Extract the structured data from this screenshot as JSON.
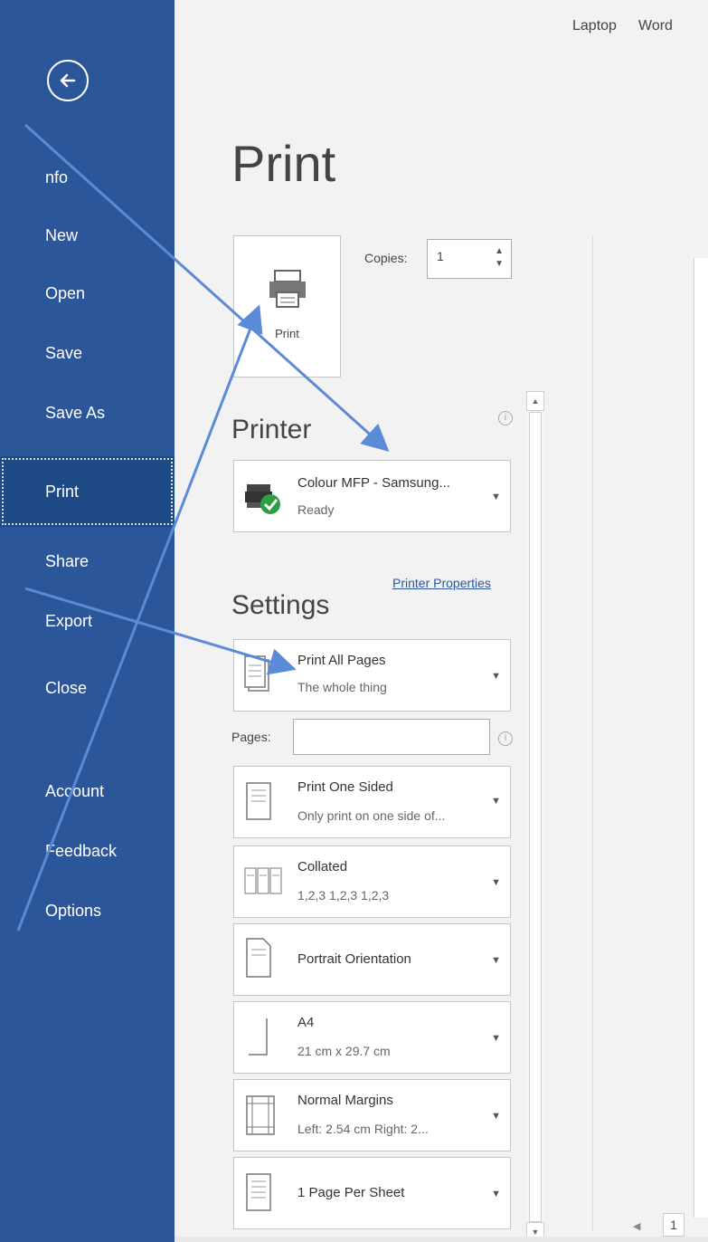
{
  "app": {
    "crumb1": "Laptop",
    "crumb2": "Word"
  },
  "nav": {
    "items": [
      {
        "label": "nfo"
      },
      {
        "label": "New"
      },
      {
        "label": "Open"
      },
      {
        "label": "Save"
      },
      {
        "label": "Save As"
      },
      {
        "label": "Print"
      },
      {
        "label": "Share"
      },
      {
        "label": "Export"
      },
      {
        "label": "Close"
      },
      {
        "label": "Account"
      },
      {
        "label": "Feedback"
      },
      {
        "label": "Options"
      }
    ]
  },
  "print": {
    "title": "Print",
    "button_label": "Print",
    "copies_label": "Copies:",
    "copies_value": "1"
  },
  "printer": {
    "heading": "Printer",
    "name": "Colour MFP - Samsung...",
    "status": "Ready",
    "properties_link": "Printer Properties"
  },
  "settings": {
    "heading": "Settings",
    "pages_label": "Pages:",
    "pages_value": "",
    "items": [
      {
        "line1": "Print All Pages",
        "line2": "The whole thing"
      },
      {
        "line1": "Print One Sided",
        "line2": "Only print on one side of..."
      },
      {
        "line1": "Collated",
        "line2": "1,2,3   1,2,3   1,2,3"
      },
      {
        "line1": "Portrait Orientation",
        "line2": ""
      },
      {
        "line1": "A4",
        "line2": "21 cm x 29.7 cm"
      },
      {
        "line1": "Normal Margins",
        "line2": "Left: 2.54 cm   Right: 2..."
      },
      {
        "line1": "1 Page Per Sheet",
        "line2": ""
      }
    ]
  },
  "preview": {
    "page_number": "1"
  },
  "colors": {
    "sidebar": "#2b579a",
    "arrow": "#5b8ad6"
  }
}
